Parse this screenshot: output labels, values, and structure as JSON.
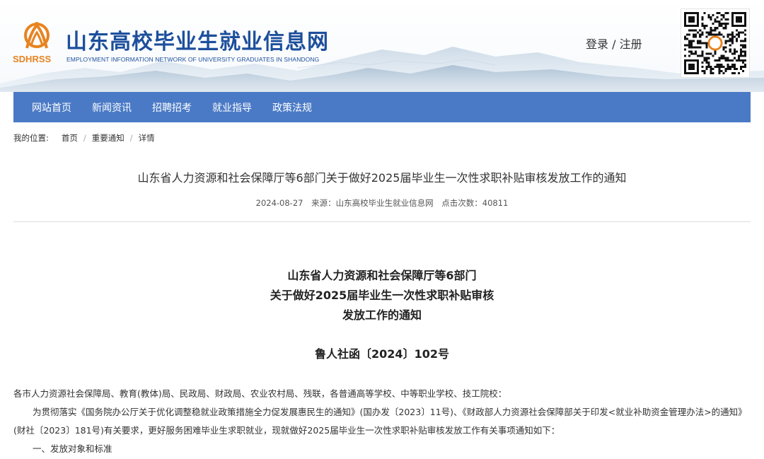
{
  "header": {
    "logo_abbr": "SDHRSS",
    "site_title": "山东高校毕业生就业信息网",
    "site_subtitle": "EMPLOYMENT INFORMATION NETWORK OF UNIVERSITY GRADUATES IN SHANDONG",
    "login": "登录",
    "auth_sep": " / ",
    "register": "注册",
    "brand_color": "#1d4f9c",
    "logo_color": "#e8831f"
  },
  "nav": {
    "items": [
      "网站首页",
      "新闻资讯",
      "招聘招考",
      "就业指导",
      "政策法规"
    ],
    "bg_color": "#4a7ac6"
  },
  "breadcrumb": {
    "label": "我的位置:",
    "items": [
      "首页",
      "重要通知",
      "详情"
    ]
  },
  "article": {
    "title": "山东省人力资源和社会保障厅等6部门关于做好2025届毕业生一次性求职补贴审核发放工作的通知",
    "date": "2024-08-27",
    "source": "来源：山东高校毕业生就业信息网",
    "clicks": "点击次数：40811"
  },
  "document": {
    "head_lines": [
      "山东省人力资源和社会保障厅等6部门",
      "关于做好2025届毕业生一次性求职补贴审核",
      "发放工作的通知"
    ],
    "doc_number": "鲁人社函〔2024〕102号",
    "addressees": "各市人力资源社会保障局、教育(教体)局、民政局、财政局、农业农村局、残联，各普通高等学校、中等职业学校、技工院校：",
    "para1": "为贯彻落实《国务院办公厅关于优化调整稳就业政策措施全力促发展惠民生的通知》(国办发〔2023〕11号)、《财政部人力资源社会保障部关于印发<就业补助资金管理办法>的通知》(财社〔2023〕181号)有关要求，更好服务困难毕业生求职就业，现就做好2025届毕业生一次性求职补贴审核发放工作有关事项通知如下：",
    "section1": "一、发放对象和标准"
  }
}
